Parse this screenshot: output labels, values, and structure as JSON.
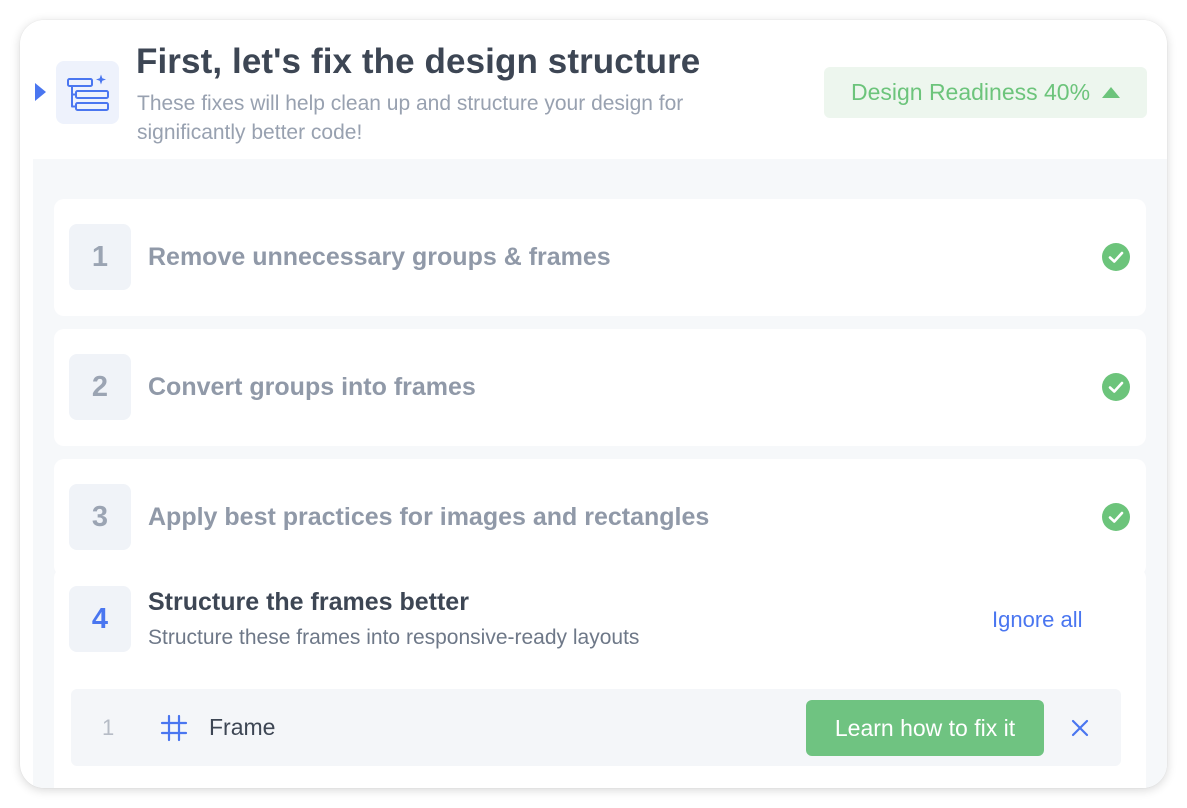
{
  "header": {
    "title": "First, let's fix the design structure",
    "subtitle": "These fixes will help clean up and structure your design for significantly better code!",
    "readiness_label": "Design Readiness 40%",
    "readiness_percent": 40,
    "icon": "layers-sparkle-icon",
    "collapse_icon": "caret-right-icon",
    "readiness_icon": "triangle-up-icon"
  },
  "steps": [
    {
      "number": "1",
      "label": "Remove unnecessary groups & frames",
      "status_icon": "check-circle-icon"
    },
    {
      "number": "2",
      "label": "Convert groups into frames",
      "status_icon": "check-circle-icon"
    },
    {
      "number": "3",
      "label": "Apply best practices for images and rectangles",
      "status_icon": "check-circle-icon"
    }
  ],
  "active_step": {
    "number": "4",
    "title": "Structure the frames better",
    "subtitle": "Structure these frames into responsive-ready layouts",
    "ignore_all_label": "Ignore all",
    "items": [
      {
        "index": "1",
        "icon": "hash-frame-icon",
        "label": "Frame",
        "fix_button_label": "Learn how to fix it",
        "dismiss_icon": "close-icon"
      }
    ]
  },
  "colors": {
    "accent": "#4a76f0",
    "success": "#6cc47b",
    "success_bg": "#edf6ee",
    "title_text": "#3d4654",
    "muted_text": "#98a1b0"
  }
}
